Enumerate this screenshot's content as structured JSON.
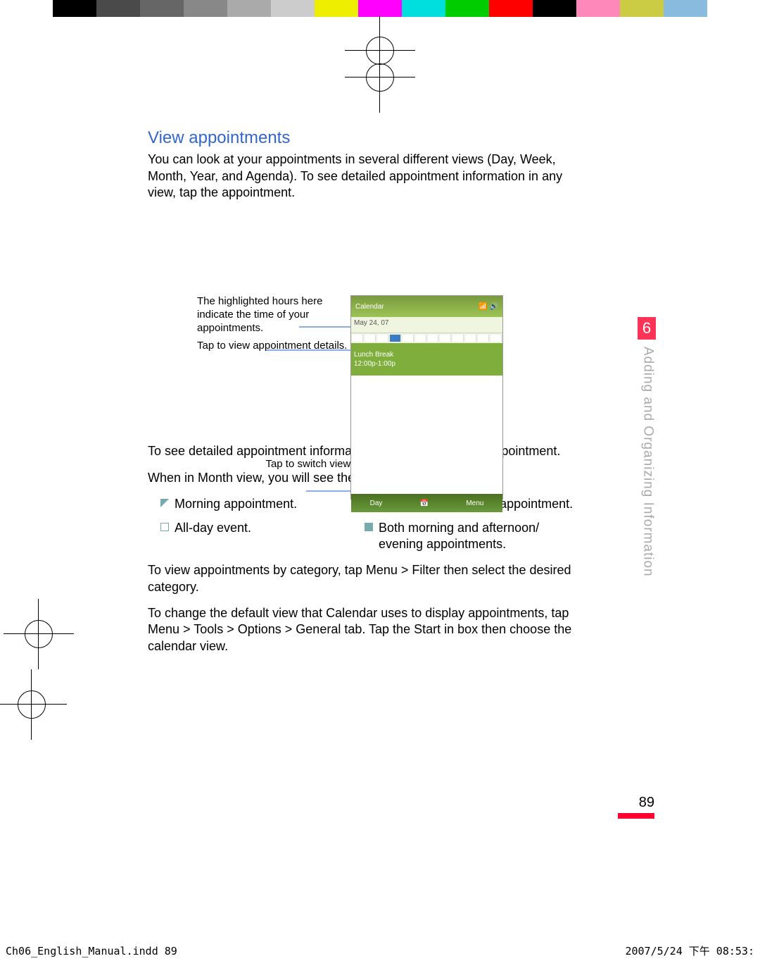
{
  "colorbar": [
    "#000000",
    "#4a4a4a",
    "#666666",
    "#888888",
    "#aaaaaa",
    "#cccccc",
    "#eeee00",
    "#ff00ff",
    "#00dddd",
    "#00cc00",
    "#ff0000",
    "#000000",
    "#ff88bb",
    "#cccc44",
    "#88bbdd"
  ],
  "heading": "View appointments",
  "intro": "You can look at your appointments in several different views (Day, Week, Month, Year, and Agenda). To see detailed appointment information in any view, tap the appointment.",
  "callout1": "The highlighted hours here indicate the time of your appointments.",
  "callout2": "Tap to view appointment details.",
  "callout3": "Tap to switch views.",
  "shot": {
    "title": "Calendar",
    "date": "May 24, 07",
    "appt1": "Lunch Break",
    "appt2": "12:00p-1:00p",
    "b1": "Day",
    "b2": "Menu"
  },
  "p2": "To see detailed appointment information in any view, tap the appointment.",
  "p3": "When in Month view, you will see the following indicators:",
  "ind": {
    "morning": "Morning appointment.",
    "afternoon": "Afternoon or evening appointment.",
    "allday": "All-day event.",
    "both": "Both morning and afternoon/\nevening appointments."
  },
  "p4": "To view appointments by category, tap Menu > Filter then select the desired category.",
  "p5": "To change the default view that Calendar uses to display appointments, tap Menu > Tools > Options > General tab. Tap the Start in box then choose the calendar view.",
  "chapter_num": "6",
  "chapter_title": "Adding and Organizing Information",
  "page_number": "89",
  "footer_left": "Ch06_English_Manual.indd   89",
  "footer_right": "2007/5/24   下午 08:53:"
}
